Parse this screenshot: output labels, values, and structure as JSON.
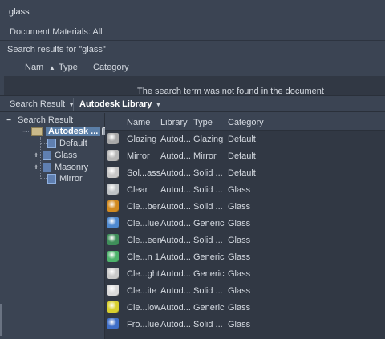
{
  "search": {
    "value": "glass"
  },
  "document_materials": "Document Materials: All",
  "results_label": "Search results for \"glass\"",
  "results_columns": {
    "name": "Nam",
    "type": "Type",
    "category": "Category"
  },
  "results_message": "The search term was not found in the document",
  "library_bar": {
    "search_result": "Search Result",
    "autodesk_library": "Autodesk Library"
  },
  "tree": {
    "root": "Search Result",
    "library": "Autodesk ...",
    "items": [
      "Default",
      "Glass",
      "Masonry",
      "Mirror"
    ]
  },
  "materials": {
    "columns": {
      "name": "Name",
      "library": "Library",
      "type": "Type",
      "category": "Category"
    },
    "rows": [
      {
        "name": "Glazing",
        "library": "Autod...",
        "type": "Glazing",
        "category": "Default",
        "swatch": "#a9a9a9"
      },
      {
        "name": "Mirror",
        "library": "Autod...",
        "type": "Mirror",
        "category": "Default",
        "swatch": "#b7b7b7"
      },
      {
        "name": "Sol...ass",
        "library": "Autod...",
        "type": "Solid ...",
        "category": "Default",
        "swatch": "#c8c8c8"
      },
      {
        "name": "Clear",
        "library": "Autod...",
        "type": "Solid ...",
        "category": "Glass",
        "swatch": "#bfc3c6"
      },
      {
        "name": "Cle...ber",
        "library": "Autod...",
        "type": "Solid ...",
        "category": "Glass",
        "swatch": "#d28a1f"
      },
      {
        "name": "Cle...lue",
        "library": "Autod...",
        "type": "Generic",
        "category": "Glass",
        "swatch": "#4f8ad0"
      },
      {
        "name": "Cle...een",
        "library": "Autod...",
        "type": "Solid ...",
        "category": "Glass",
        "swatch": "#3f8f5a"
      },
      {
        "name": "Cle...n 1",
        "library": "Autod...",
        "type": "Generic",
        "category": "Glass",
        "swatch": "#4db36b"
      },
      {
        "name": "Cle...ght",
        "library": "Autod...",
        "type": "Generic",
        "category": "Glass",
        "swatch": "#c9c9c9"
      },
      {
        "name": "Cle...ite",
        "library": "Autod...",
        "type": "Solid ...",
        "category": "Glass",
        "swatch": "#dadada"
      },
      {
        "name": "Cle...low",
        "library": "Autod...",
        "type": "Generic",
        "category": "Glass",
        "swatch": "#d8cf2e"
      },
      {
        "name": "Fro...lue",
        "library": "Autod...",
        "type": "Solid ...",
        "category": "Glass",
        "swatch": "#3f6fc8"
      }
    ]
  }
}
